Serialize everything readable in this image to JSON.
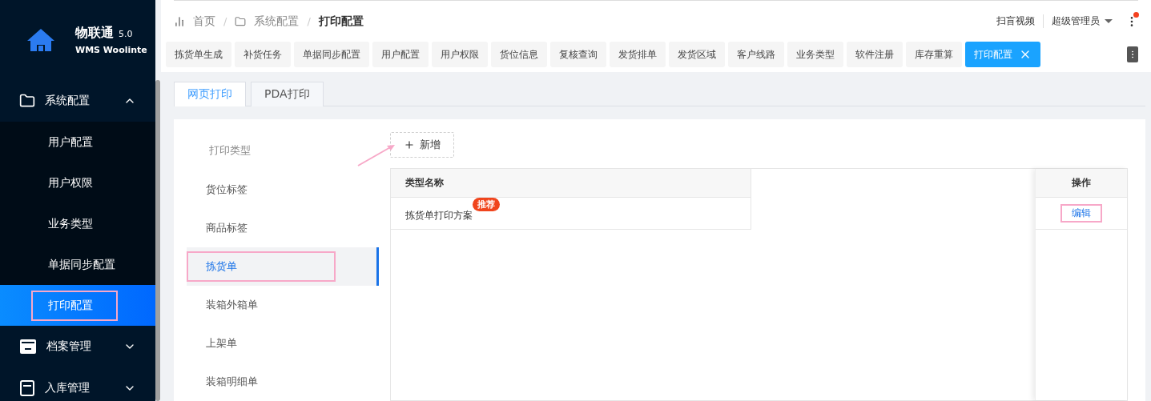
{
  "logo": {
    "name": "物联通",
    "version": "5.0",
    "subtitle": "WMS Woolinte"
  },
  "sidebar": {
    "items": [
      {
        "label": "系统配置",
        "kind": "settings",
        "expanded": true,
        "children": [
          {
            "label": "用户配置",
            "selected": false,
            "highlighted": false
          },
          {
            "label": "用户权限",
            "selected": false,
            "highlighted": false
          },
          {
            "label": "业务类型",
            "selected": false,
            "highlighted": false
          },
          {
            "label": "单据同步配置",
            "selected": false,
            "highlighted": false
          },
          {
            "label": "打印配置",
            "selected": true,
            "highlighted": true
          }
        ]
      },
      {
        "label": "档案管理",
        "kind": "archive",
        "expanded": false
      },
      {
        "label": "入库管理",
        "kind": "inbound",
        "expanded": false
      }
    ]
  },
  "breadcrumb": [
    {
      "label": "首页",
      "current": false
    },
    {
      "separator": "/",
      "label": "系统配置",
      "current": false
    },
    {
      "separator": "/",
      "label": "打印配置",
      "current": true
    }
  ],
  "header": {
    "link": "扫盲视频",
    "user": "超级管理员",
    "notification": true
  },
  "page_tabs": [
    {
      "label": "拣货单生成",
      "selected": false
    },
    {
      "label": "补货任务",
      "selected": false
    },
    {
      "label": "单据同步配置",
      "selected": false
    },
    {
      "label": "用户配置",
      "selected": false
    },
    {
      "label": "用户权限",
      "selected": false
    },
    {
      "label": "货位信息",
      "selected": false
    },
    {
      "label": "复核查询",
      "selected": false
    },
    {
      "label": "发货排单",
      "selected": false
    },
    {
      "label": "发货区域",
      "selected": false
    },
    {
      "label": "客户线路",
      "selected": false
    },
    {
      "label": "业务类型",
      "selected": false
    },
    {
      "label": "软件注册",
      "selected": false
    },
    {
      "label": "库存重算",
      "selected": false
    },
    {
      "label": "打印配置",
      "selected": true
    }
  ],
  "print_tabs": [
    {
      "label": "网页打印",
      "selected": true
    },
    {
      "label": "PDA打印",
      "selected": false
    }
  ],
  "type_list": {
    "title": "打印类型",
    "items": [
      {
        "label": "货位标签",
        "selected": false,
        "highlighted": false
      },
      {
        "label": "商品标签",
        "selected": false,
        "highlighted": false
      },
      {
        "label": "拣货单",
        "selected": true,
        "highlighted": true
      },
      {
        "label": "装箱外箱单",
        "selected": false,
        "highlighted": false
      },
      {
        "label": "上架单",
        "selected": false,
        "highlighted": false
      },
      {
        "label": "装箱明细单",
        "selected": false,
        "highlighted": false
      }
    ]
  },
  "add_button": "新增",
  "table": {
    "columns": [
      "类型名称",
      "操作"
    ],
    "rows": [
      {
        "name": "拣货单打印方案",
        "badge": "推荐",
        "action": "编辑",
        "action_highlighted": true
      }
    ]
  }
}
